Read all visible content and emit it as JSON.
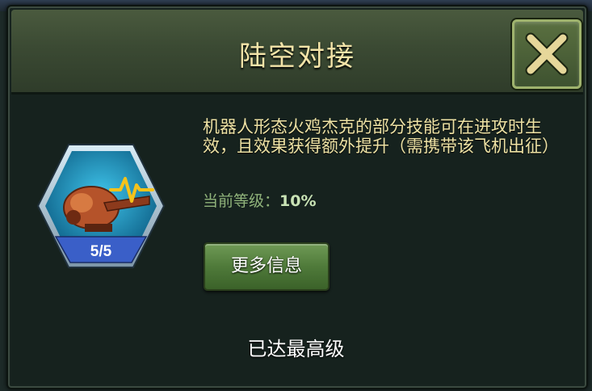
{
  "dialog": {
    "title": "陆空对接",
    "description": "机器人形态火鸡杰克的部分技能可在进攻时生效，且效果获得额外提升（需携带该飞机出征）",
    "level_label": "当前等级：",
    "level_value": "10%",
    "more_info_button": "更多信息",
    "status": "已达最高级"
  },
  "skill_badge": {
    "progress": "5/5",
    "icon": "pulse-icon"
  },
  "colors": {
    "title": "#f3e4a8",
    "description": "#eee2a4",
    "level_label": "#8fb27a",
    "button_green": "#4f7a3a",
    "badge_blue": "#3a5fc8"
  }
}
